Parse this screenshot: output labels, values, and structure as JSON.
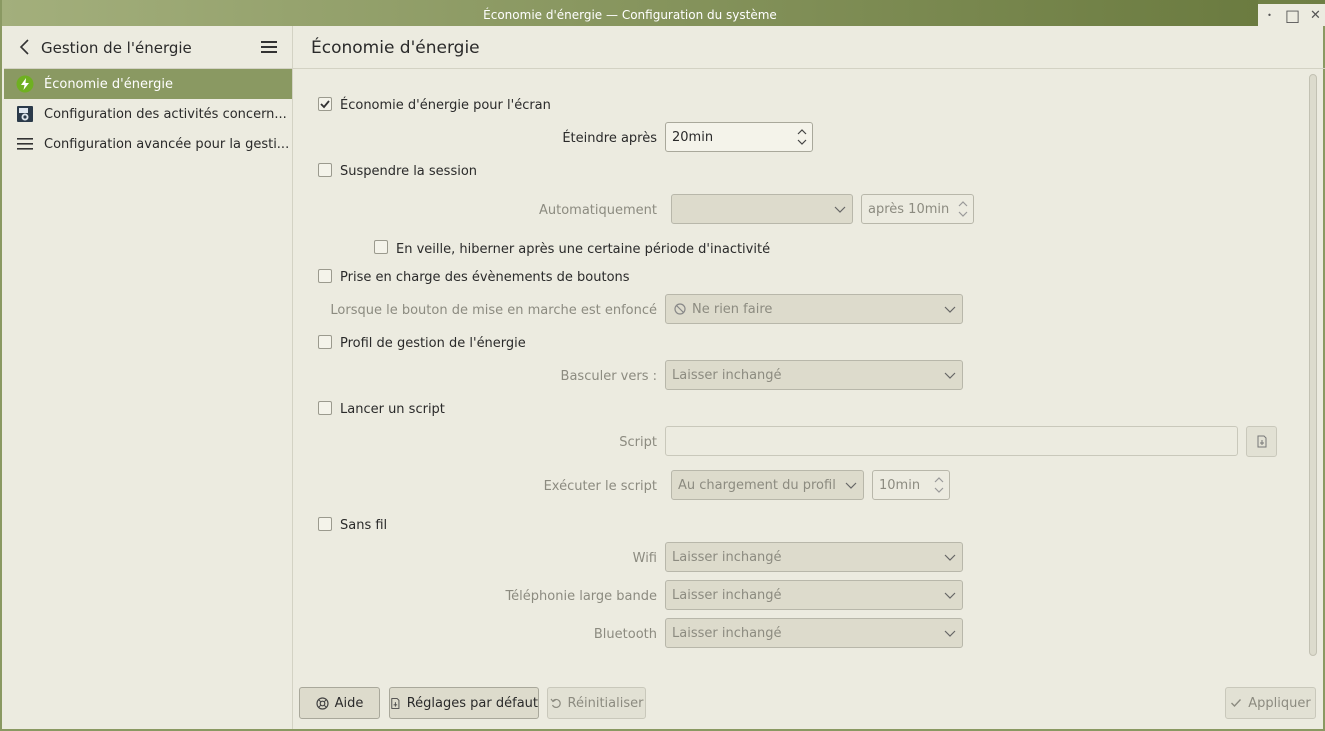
{
  "window": {
    "title": "Économie d'énergie — Configuration du système",
    "controls": {
      "minimize": "•",
      "maximize": "□",
      "close": "✕"
    }
  },
  "sidebar": {
    "title": "Gestion de l'énergie",
    "back_icon": "chevron-left-icon",
    "menu_icon": "hamburger-icon",
    "items": [
      {
        "label": "Économie d'énergie",
        "icon": "power-saving-icon",
        "active": true
      },
      {
        "label": "Configuration des activités concern...",
        "icon": "activities-icon",
        "active": false
      },
      {
        "label": "Configuration avancée pour la gesti...",
        "icon": "list-icon",
        "active": false
      }
    ]
  },
  "main": {
    "title": "Économie d'énergie",
    "screen_saving": {
      "label": "Économie d'énergie pour l'écran",
      "checked": true,
      "off_after_label": "Éteindre après",
      "off_after_value": "20min"
    },
    "suspend": {
      "label": "Suspendre la session",
      "checked": false,
      "auto_label": "Automatiquement",
      "auto_value": "",
      "after_value": "après 10min",
      "hibernate_label": "En veille, hiberner après une certaine période d'inactivité"
    },
    "buttons_events": {
      "label": "Prise en charge des évènements de boutons",
      "checked": false,
      "power_button_label": "Lorsque le bouton de mise en marche est enfoncé",
      "power_button_value": "Ne rien faire"
    },
    "profile": {
      "label": "Profil de gestion de l'énergie",
      "checked": false,
      "switch_label": "Basculer vers :",
      "switch_value": "Laisser inchangé"
    },
    "script": {
      "label": "Lancer un script",
      "checked": false,
      "script_label": "Script",
      "script_value": "",
      "run_label": "Exécuter le script",
      "run_value": "Au chargement du profil",
      "run_after": "10min"
    },
    "wireless": {
      "label": "Sans fil",
      "checked": false,
      "wifi_label": "Wifi",
      "wifi_value": "Laisser inchangé",
      "mobile_label": "Téléphonie large bande",
      "mobile_value": "Laisser inchangé",
      "bt_label": "Bluetooth",
      "bt_value": "Laisser inchangé"
    }
  },
  "footer": {
    "help": "Aide",
    "defaults": "Réglages par défaut",
    "reset": "Réinitialiser",
    "apply": "Appliquer"
  },
  "colors": {
    "accent": "#8a9962",
    "background": "#ecebe0",
    "power_icon": "#6fb021"
  }
}
